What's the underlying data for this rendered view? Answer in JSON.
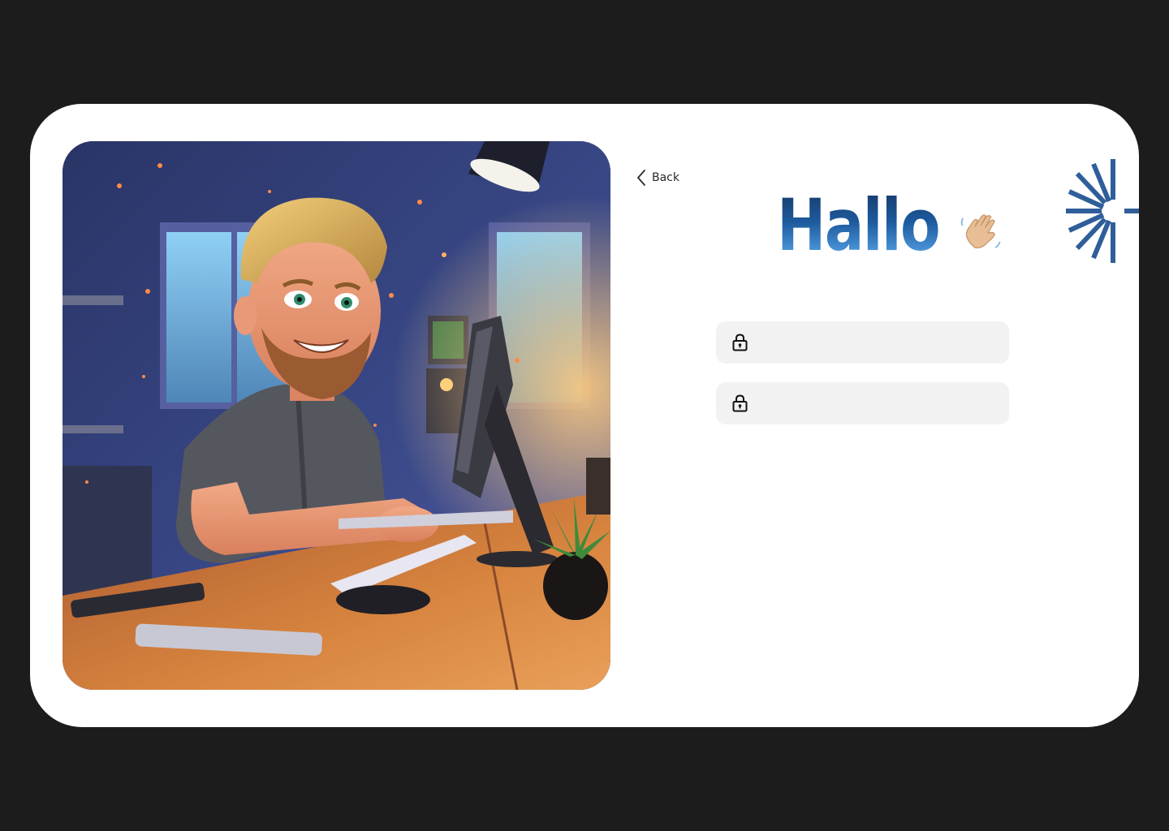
{
  "nav": {
    "back_label": "Back"
  },
  "greeting": {
    "title": "Hallo"
  },
  "form": {
    "fields": [
      {
        "value": "",
        "placeholder": "",
        "icon": "lock-icon"
      },
      {
        "value": "",
        "placeholder": "",
        "icon": "lock-icon"
      }
    ]
  },
  "colors": {
    "background": "#1c1c1c",
    "card": "#ffffff",
    "field": "#f2f2f2",
    "accent": "#1d5a9e"
  }
}
